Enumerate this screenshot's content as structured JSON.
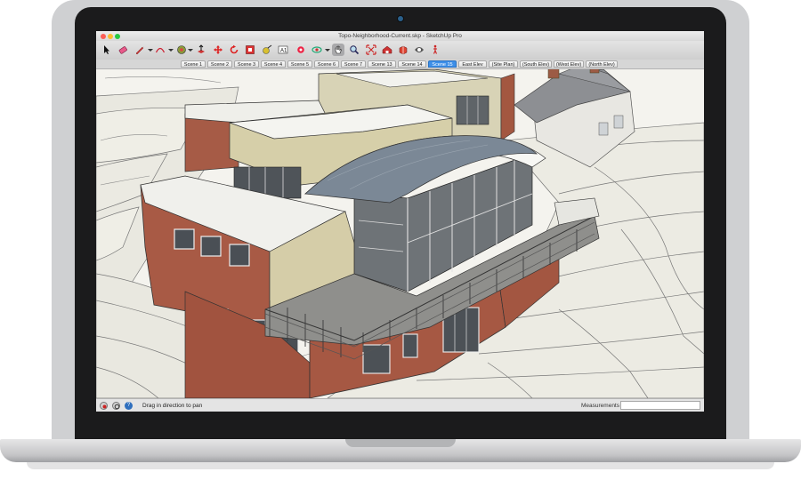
{
  "window": {
    "title": "Topo-Neighborhood-Current.skp - SketchUp Pro"
  },
  "toolbar": {
    "tools": [
      {
        "icon": "select-arrow-icon"
      },
      {
        "icon": "eraser-icon"
      },
      {
        "icon": "pencil-line-icon"
      },
      {
        "icon": "arc-icon"
      },
      {
        "icon": "paint-bucket-icon"
      },
      {
        "icon": "push-pull-icon"
      },
      {
        "icon": "move-icon"
      },
      {
        "icon": "rotate-icon"
      },
      {
        "icon": "scale-icon"
      },
      {
        "icon": "tape-measure-icon"
      },
      {
        "icon": "text-icon"
      },
      {
        "icon": "orbit-icon"
      },
      {
        "icon": "pan-hand-icon"
      },
      {
        "icon": "zoom-icon"
      },
      {
        "icon": "zoom-extents-icon"
      },
      {
        "icon": "warehouse-icon"
      },
      {
        "icon": "extension-warehouse-icon"
      },
      {
        "icon": "layout-icon"
      },
      {
        "icon": "section-plane-icon"
      },
      {
        "icon": "walk-icon"
      }
    ],
    "pressed_tool": "pan-hand-icon"
  },
  "scenes": [
    {
      "label": "Scene 1"
    },
    {
      "label": "Scene 2"
    },
    {
      "label": "Scene 3"
    },
    {
      "label": "Scene 4"
    },
    {
      "label": "Scene 5"
    },
    {
      "label": "Scene 6"
    },
    {
      "label": "Scene 7"
    },
    {
      "label": "Scene 13"
    },
    {
      "label": "Scene 14"
    },
    {
      "label": "Scene 15",
      "active": true
    },
    {
      "label": "East Elev"
    },
    {
      "label": "(Site Plan)"
    },
    {
      "label": "(South Elev)"
    },
    {
      "label": "(West Elev)"
    },
    {
      "label": "(North Elev)"
    }
  ],
  "status": {
    "hint": "Drag in direction to pan",
    "measurements_label": "Measurements",
    "measurements_value": "",
    "icons": [
      "geo-location-icon",
      "credits-icon",
      "help-icon"
    ]
  },
  "colors": {
    "active_tab": "#3d8fe8",
    "brick": "#a85a45",
    "roof_metal": "#7b8896",
    "terrain_lines": "#7a7a7a"
  }
}
